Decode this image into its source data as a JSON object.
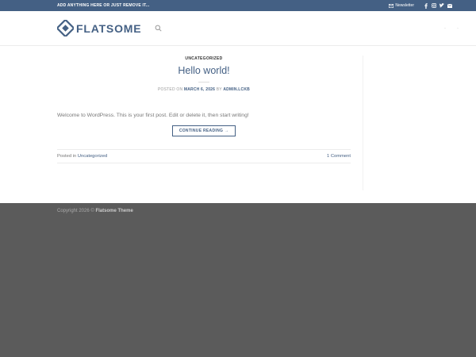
{
  "topbar": {
    "announcement": "ADD ANYTHING HERE OR JUST REMOVE IT...",
    "newsletter": "Newsletter",
    "icons": [
      "mail-icon",
      "facebook-icon",
      "instagram-icon",
      "twitter-icon",
      "email-icon"
    ]
  },
  "header": {
    "logo_text": "FLATSOME",
    "icons": [
      "search-icon"
    ]
  },
  "post": {
    "category": "UNCATEGORIZED",
    "title": "Hello world!",
    "meta_prefix": "POSTED ON",
    "date": "MARCH 6, 2026",
    "meta_by": "BY",
    "author": "ADMIN.LCKB",
    "excerpt": "Welcome to WordPress. This is your first post. Edit or delete it, then start writing!",
    "continue_label": "CONTINUE READING →",
    "posted_in_label": "Posted in",
    "posted_in_category": "Uncategorized",
    "comments": "1 Comment"
  },
  "footer": {
    "copyright_prefix": "Copyright 2026 ©",
    "theme_name": "Flatsome Theme"
  },
  "colors": {
    "brand": "#446084",
    "footer_bg": "#5b5b5b"
  }
}
